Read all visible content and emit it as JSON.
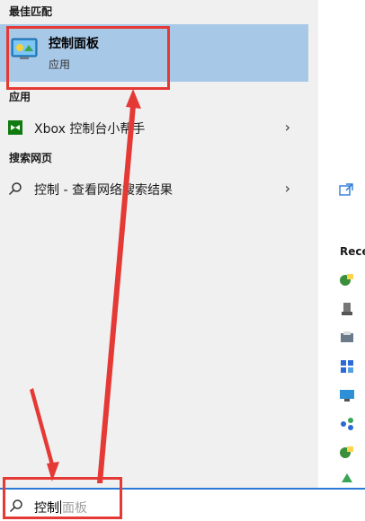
{
  "sections": {
    "best_match": "最佳匹配",
    "apps": "应用",
    "web": "搜索网页"
  },
  "best_match": {
    "title": "控制面板",
    "subtitle": "应用",
    "icon": "control-panel-icon"
  },
  "apps_list": [
    {
      "label": "Xbox 控制台小帮手",
      "icon": "xbox-icon"
    }
  ],
  "web_list": [
    {
      "label": "控制 - 查看网络搜索结果",
      "icon": "search-icon"
    }
  ],
  "search": {
    "typed": "控制",
    "suggestion": "面板"
  },
  "right_panel": {
    "label": "Rece",
    "open_icon": "open-window-icon"
  },
  "colors": {
    "highlight": "#a8c8e8",
    "accent": "#2a7ad6",
    "annotation": "#e53935"
  }
}
